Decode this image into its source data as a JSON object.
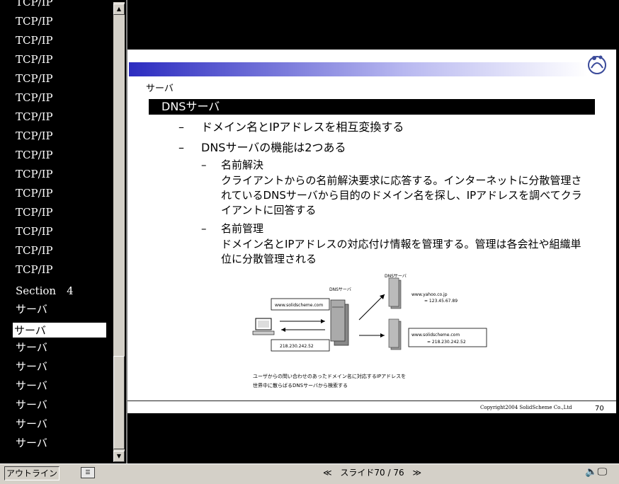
{
  "outline": {
    "items": [
      {
        "label": "TCP/IP",
        "selected": false
      },
      {
        "label": "TCP/IP",
        "selected": false
      },
      {
        "label": "TCP/IP",
        "selected": false
      },
      {
        "label": "TCP/IP",
        "selected": false
      },
      {
        "label": "TCP/IP",
        "selected": false
      },
      {
        "label": "TCP/IP",
        "selected": false
      },
      {
        "label": "TCP/IP",
        "selected": false
      },
      {
        "label": "TCP/IP",
        "selected": false
      },
      {
        "label": "TCP/IP",
        "selected": false
      },
      {
        "label": "TCP/IP",
        "selected": false
      },
      {
        "label": "TCP/IP",
        "selected": false
      },
      {
        "label": "TCP/IP",
        "selected": false
      },
      {
        "label": "TCP/IP",
        "selected": false
      },
      {
        "label": "TCP/IP",
        "selected": false
      },
      {
        "label": "TCP/IP",
        "selected": false
      },
      {
        "label": "Section　4",
        "selected": false
      },
      {
        "label": "サーバ",
        "selected": false
      },
      {
        "label": "サーバ",
        "selected": true
      },
      {
        "label": "サーバ",
        "selected": false
      },
      {
        "label": "サーバ",
        "selected": false
      },
      {
        "label": "サーバ",
        "selected": false
      },
      {
        "label": "サーバ",
        "selected": false
      },
      {
        "label": "サーバ",
        "selected": false
      },
      {
        "label": "サーバ",
        "selected": false
      }
    ]
  },
  "slide": {
    "section_label": "サーバ",
    "title": "DNSサーバ",
    "bullet1": "ドメイン名とIPアドレスを相互変換する",
    "bullet2": "DNSサーバの機能は2つある",
    "sub1_head": "名前解決",
    "sub1_body": "クライアントからの名前解決要求に応答する。インターネットに分散管理されているDNSサーバから目的のドメイン名を探し、IPアドレスを調べてクライアントに回答する",
    "sub2_head": "名前管理",
    "sub2_body": "ドメイン名とIPアドレスの対応付け情報を管理する。管理は各会社や組織単位に分散管理される",
    "dash": "–",
    "diagram": {
      "dns_server_label_top": "DNSサーバ",
      "dns_server_label_mid": "DNSサーバ",
      "query_box": "www.solidscheme.com",
      "answer_box": "218.230.242.52",
      "yahoo_line1": "www.yahoo.co.jp",
      "yahoo_line2": "= 123.45.67.89",
      "solid_line1": "www.solidscheme.com",
      "solid_line2": "= 218.230.242.52",
      "caption_line1": "ユーザからの問い合わせのあったドメイン名に対応するIPアドレスを",
      "caption_line2": "世界中に散らばるDNSサーバから検索する"
    },
    "copyright": "Copyright2004 SolidScheme Co.,Ltd",
    "page_number": "70"
  },
  "bottombar": {
    "outline_button": "アウトライン",
    "nav_prev": "≪",
    "nav_text": "スライド70 / 76",
    "nav_next": "≫",
    "icons": [
      "speaker-icon",
      "monitor-icon"
    ]
  },
  "colors": {
    "title_bar": "#000000",
    "gradient_start": "#2c2cc0"
  }
}
